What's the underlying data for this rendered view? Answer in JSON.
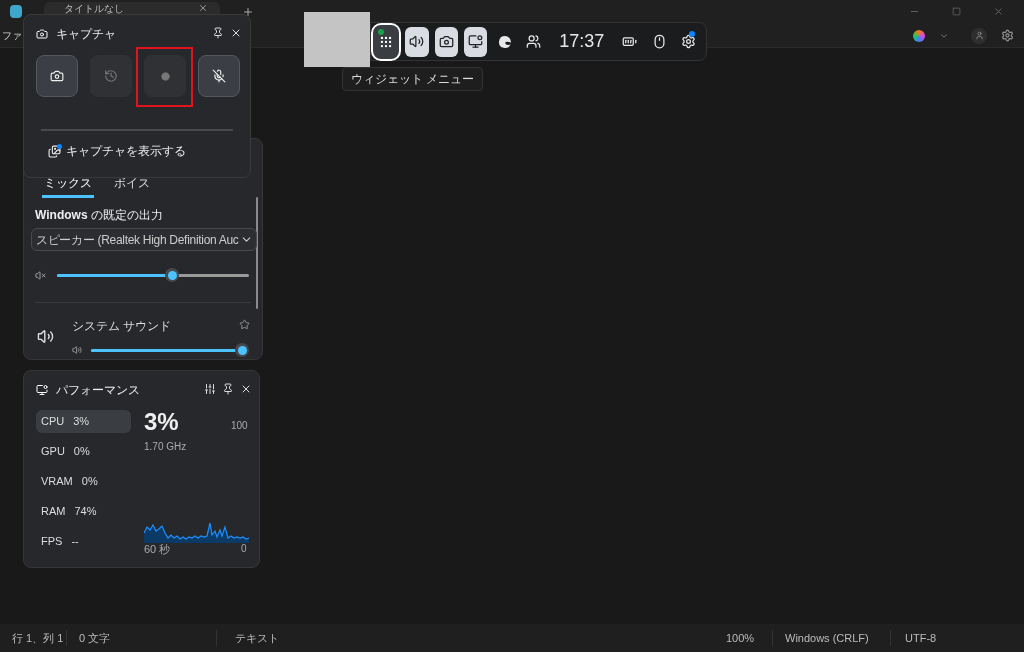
{
  "notepad": {
    "tab_title": "タイトルなし",
    "menu": [
      "ファ"
    ],
    "status_bar": [
      "行 1、列 1",
      "0 文字",
      "テキスト",
      "100%",
      "Windows (CRLF)",
      "UTF-8"
    ]
  },
  "game_bar": {
    "items": [
      {
        "kind": "widget_menu",
        "active": true
      },
      {
        "kind": "audio",
        "active": true
      },
      {
        "kind": "capture",
        "active": true
      },
      {
        "kind": "performance",
        "active": true
      },
      {
        "kind": "browser",
        "active": false
      },
      {
        "kind": "social",
        "active": false
      },
      {
        "kind": "time",
        "label": "17:37"
      },
      {
        "kind": "battery",
        "active": false
      },
      {
        "kind": "mouse",
        "active": false
      },
      {
        "kind": "settings",
        "active": false,
        "notification": true
      }
    ],
    "tooltip": "ウィジェット メニュー"
  },
  "capture": {
    "title": "キャプチャ",
    "buttons": [
      {
        "kind": "screenshot",
        "disabled": false,
        "highlighted": false
      },
      {
        "kind": "record_last",
        "disabled": true,
        "highlighted": false
      },
      {
        "kind": "record",
        "disabled": true,
        "highlighted": true
      },
      {
        "kind": "mic",
        "disabled": false,
        "highlighted": false
      }
    ],
    "link": "キャプチャを表示する"
  },
  "audio": {
    "tabs": [
      {
        "label": "ミックス",
        "selected": true
      },
      {
        "label": "ボイス",
        "selected": false
      }
    ],
    "output_label": "**Windows** の既定の出力",
    "device": "スピーカー (Realtek High Definition Auc",
    "master": {
      "muted": true,
      "level": 0.6
    },
    "apps": [
      {
        "name": "システム サウンド",
        "favorite": false,
        "level": 0.97
      }
    ]
  },
  "performance": {
    "title": "パフォーマンス",
    "metrics": [
      {
        "label": "CPU",
        "value": "3%",
        "selected": true
      },
      {
        "label": "GPU",
        "value": "0%",
        "selected": false
      },
      {
        "label": "VRAM",
        "value": "0%",
        "selected": false
      },
      {
        "label": "RAM",
        "value": "74%",
        "selected": false
      },
      {
        "label": "FPS",
        "value": "--",
        "selected": false
      }
    ],
    "big_value": "3%",
    "frequency": "1.70 GHz",
    "max_label": "100",
    "time_label": "60 秒",
    "min_label": "0"
  }
}
